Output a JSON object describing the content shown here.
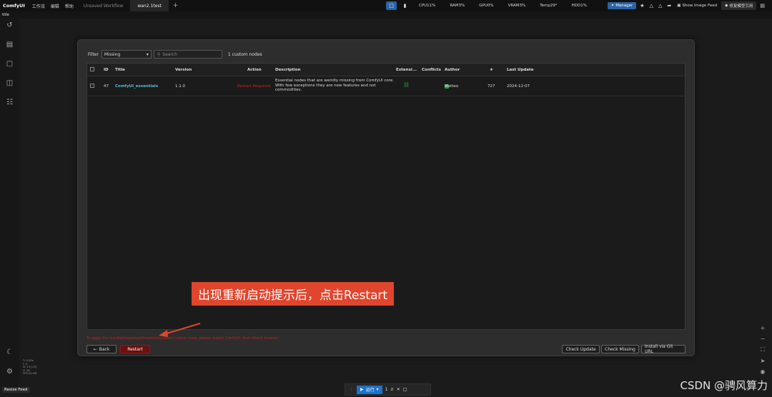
{
  "topbar": {
    "brand": "ComfyUI",
    "menus": [
      "工作流",
      "编辑",
      "帮助"
    ],
    "tabs": [
      {
        "label": "Unsaved Workflow",
        "active": false
      },
      {
        "label": "wan2.1test",
        "active": true
      }
    ],
    "add_tab": "+",
    "stats": [
      "CPU11%",
      "RAM3%",
      "GPU0%",
      "VRAM3%",
      "Temp29°",
      "HDD1%"
    ],
    "manager_label": "Manager",
    "feed_label": "Show Image Feed",
    "repair_label": "修复模型引用"
  },
  "subbar": {
    "label": "title"
  },
  "dialog": {
    "filter_label": "Filter",
    "filter_value": "Missing",
    "search_placeholder": "Search",
    "custom_count": "1 custom nodes",
    "columns": {
      "id": "ID",
      "title": "Title",
      "version": "Version",
      "action": "Action",
      "description": "Description",
      "extension": "Extensi...",
      "conflicts": "Conflicts",
      "author": "Author",
      "stars": "★",
      "last_update": "Last Update"
    },
    "rows": [
      {
        "id": "47",
        "title": "ComfyUI_essentials",
        "version": "1.1.0",
        "action": "Restart Required",
        "description": "Essential nodes that are weirdly missing from ComfyUI core. With few exceptions they are new features and not commodities.",
        "author": "Matteo",
        "stars": "727",
        "last_update": "2024-12-07"
      }
    ],
    "warning": "To apply the installed/updated/disabled/enabled custom node, please restart ComfyUI. And refresh browser.",
    "back_label": "Back",
    "restart_label": "Restart",
    "check_update_label": "Check Update",
    "check_missing_label": "Check Missing",
    "install_git_label": "Install via Git URL"
  },
  "annotation": {
    "text": "出现重新启动提示后，点击Restart",
    "color": "#e0452d"
  },
  "stats_overlay": [
    "T: 0.00s",
    "I: 0",
    "N: 13 [13]",
    "V: 26",
    "FPS:31.88"
  ],
  "resize_feed": "Resize Feed",
  "bottom": {
    "run_label": "运行",
    "batch": "1"
  },
  "watermark": "CSDN @骋风算力",
  "colors": {
    "accent": "#2a64a4",
    "restart": "#6b0e0e",
    "danger": "#d02020",
    "link": "#5cb8d8"
  }
}
